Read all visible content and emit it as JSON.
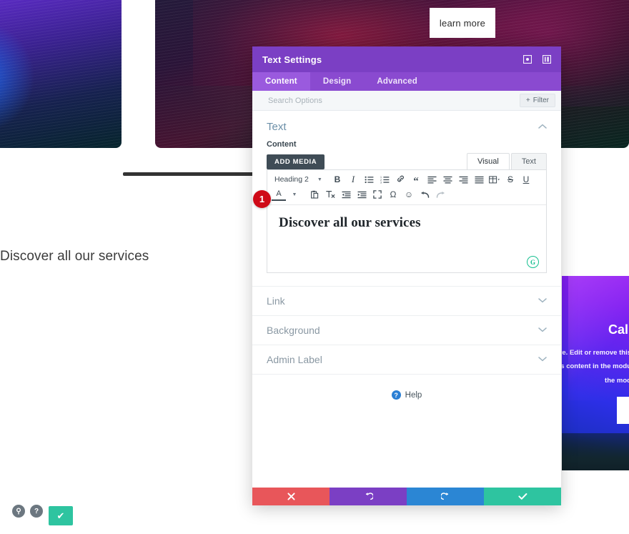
{
  "page": {
    "learn_more_label": "learn more",
    "heading": "Discover all our services",
    "promo": {
      "title": "Call",
      "lines": [
        "here. Edit or remove this",
        "f this content in the modu",
        "the mod"
      ]
    },
    "float_controls": {
      "search_glyph": "⚲",
      "help_glyph": "?",
      "save_glyph": "✔"
    }
  },
  "modal": {
    "title": "Text Settings",
    "header_icons": [
      {
        "name": "expand-icon",
        "glyph": "▣"
      },
      {
        "name": "layout-icon",
        "glyph": "▤"
      }
    ],
    "tabs": [
      {
        "label": "Content",
        "active": true
      },
      {
        "label": "Design",
        "active": false
      },
      {
        "label": "Advanced",
        "active": false
      }
    ],
    "search": {
      "placeholder": "Search Options",
      "value": ""
    },
    "filter_label": "Filter",
    "filter_plus": "+",
    "section": {
      "title": "Text",
      "collapse_glyph": "⌃"
    },
    "content_field": {
      "label": "Content",
      "add_media_label": "ADD MEDIA",
      "view_tabs": [
        {
          "label": "Visual",
          "active": true
        },
        {
          "label": "Text",
          "active": false
        }
      ],
      "format_select": "Heading 2",
      "toolbar_row1": [
        {
          "name": "bold-icon",
          "glyph": "B",
          "style": "bold"
        },
        {
          "name": "italic-icon",
          "glyph": "I",
          "style": "italic-serif"
        },
        {
          "name": "bullet-list-icon",
          "glyph": "☰",
          "style": "small"
        },
        {
          "name": "numbered-list-icon",
          "glyph": "☷",
          "style": "small"
        },
        {
          "name": "link-icon",
          "glyph": "🔗",
          "style": "small"
        },
        {
          "name": "blockquote-icon",
          "glyph": "“",
          "style": "quote"
        },
        {
          "name": "align-left-icon",
          "glyph": "≡",
          "style": "small"
        },
        {
          "name": "align-center-icon",
          "glyph": "≡",
          "style": "small"
        },
        {
          "name": "align-right-icon",
          "glyph": "≡",
          "style": "small"
        },
        {
          "name": "align-justify-icon",
          "glyph": "≡",
          "style": "small"
        },
        {
          "name": "table-icon",
          "glyph": "⊞",
          "style": "small"
        },
        {
          "name": "strikethrough-icon",
          "glyph": "S",
          "style": "strike"
        },
        {
          "name": "underline-icon",
          "glyph": "U",
          "style": "underline"
        }
      ],
      "toolbar_row2": [
        {
          "name": "text-color-icon",
          "glyph": "A",
          "style": "underline"
        },
        {
          "name": "paste-as-text-icon",
          "glyph": "📋",
          "style": "small"
        },
        {
          "name": "clear-formatting-icon",
          "glyph": "Tₓ",
          "style": "small"
        },
        {
          "name": "outdent-icon",
          "glyph": "⇤",
          "style": "small"
        },
        {
          "name": "indent-icon",
          "glyph": "⇥",
          "style": "small"
        },
        {
          "name": "fullscreen-icon",
          "glyph": "⛶",
          "style": "small"
        },
        {
          "name": "special-character-icon",
          "glyph": "Ω",
          "style": "small"
        },
        {
          "name": "emoji-icon",
          "glyph": "☺",
          "style": "small"
        },
        {
          "name": "undo-icon",
          "glyph": "↶",
          "style": "small"
        },
        {
          "name": "redo-icon",
          "glyph": "↷",
          "style": "muted"
        }
      ],
      "editor_text": "Discover all our services",
      "grammarly_glyph": "G"
    },
    "accordion": [
      {
        "label": "Link",
        "chevron": "⌄"
      },
      {
        "label": "Background",
        "chevron": "⌄"
      },
      {
        "label": "Admin Label",
        "chevron": "⌄"
      }
    ],
    "help": {
      "icon_glyph": "?",
      "label": "Help"
    },
    "footer": [
      {
        "name": "cancel-button",
        "glyph": "✖",
        "color": "#e8565a"
      },
      {
        "name": "undo-button",
        "glyph": "↺",
        "color": "#7b3fc4"
      },
      {
        "name": "redo-button",
        "glyph": "↻",
        "color": "#2b86d4"
      },
      {
        "name": "save-button",
        "glyph": "✔",
        "color": "#2ec4a0"
      }
    ]
  },
  "annotation": {
    "step_number": "1"
  },
  "colors": {
    "purple_header": "#7b3fc4",
    "purple_tabbar": "#8a4ad0",
    "accent_teal": "#2ec4a0",
    "danger_red": "#e8565a",
    "blue": "#2b86d4",
    "badge_red": "#cf0a17"
  }
}
